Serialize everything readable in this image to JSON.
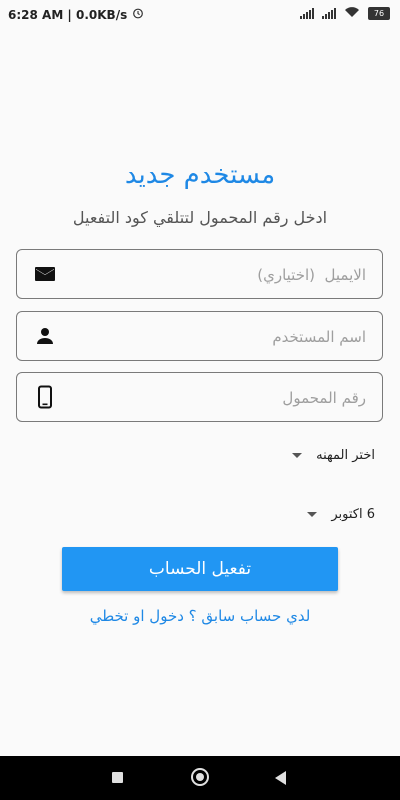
{
  "status_bar": {
    "time_speed": "6:28 AM | 0.0KB/s",
    "alarm_icon": "alarm-clock-icon",
    "battery": "76"
  },
  "form": {
    "title": "مستخدم جديد",
    "subtitle": "ادخل رقم المحمول لتتلقي كود التفعيل",
    "email": {
      "placeholder": "الايميل  (اختياري)",
      "icon": "mail-icon"
    },
    "username": {
      "placeholder": "اسم المستخدم",
      "icon": "person-icon"
    },
    "phone": {
      "placeholder": "رقم المحمول",
      "icon": "mobile-phone-icon"
    },
    "profession_dropdown": {
      "value": "اختر المهنه"
    },
    "city_dropdown": {
      "value": "6 اكتوبر"
    },
    "activate_button": "تفعيل الحساب",
    "login_link": "لدي حساب سابق ؟ دخول او تخطي"
  },
  "colors": {
    "accent": "#1e88e5",
    "button": "#2196f3"
  },
  "nav_bar": {
    "icons": [
      "recent-apps-icon",
      "home-icon",
      "back-icon"
    ]
  }
}
